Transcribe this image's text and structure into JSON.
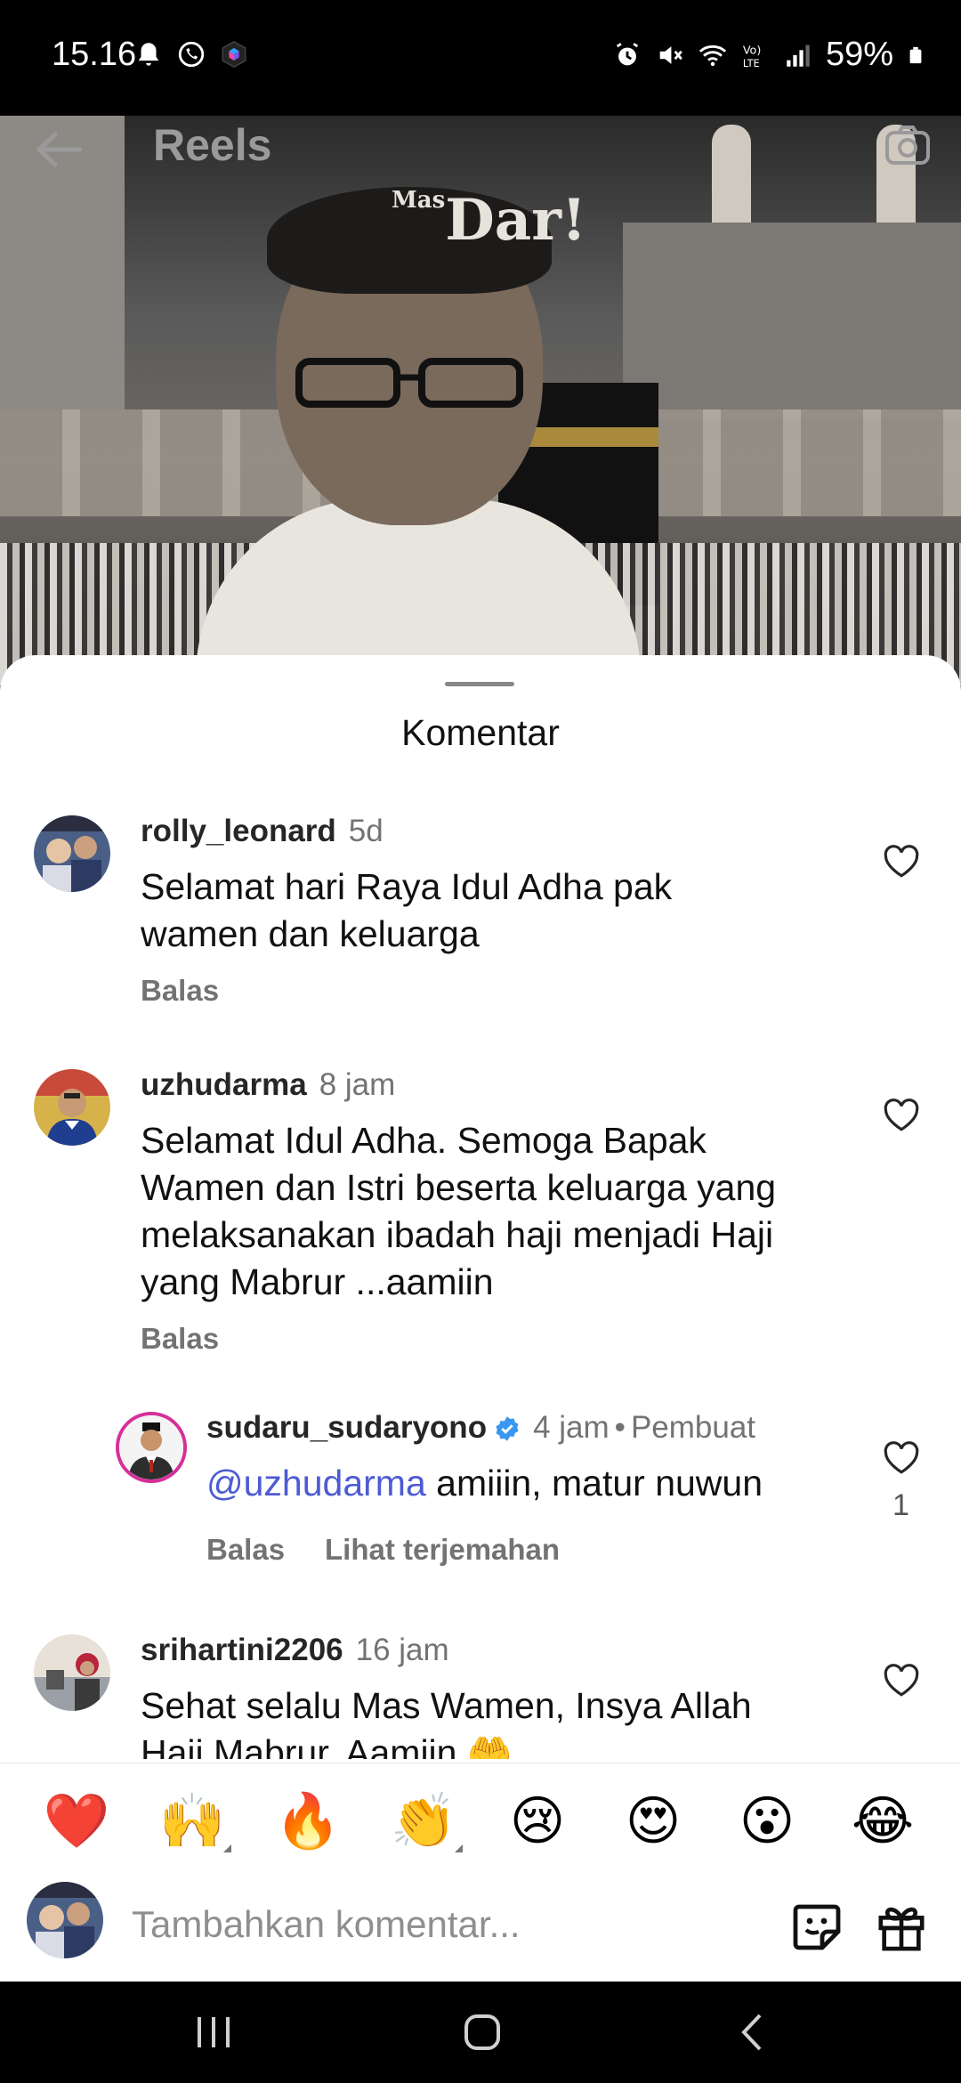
{
  "status_bar": {
    "time": "15.16",
    "battery": "59%",
    "left_icons": [
      "bell-icon",
      "whatsapp-icon",
      "app-icon"
    ],
    "right_icons": [
      "alarm-icon",
      "mute-icon",
      "wifi-icon",
      "volte-icon",
      "signal-icon",
      "battery-icon"
    ]
  },
  "reels": {
    "title": "Reels",
    "watermark_prefix": "Mas",
    "watermark": "Dar!"
  },
  "sheet": {
    "title": "Komentar"
  },
  "comments": [
    {
      "username": "rolly_leonard",
      "time": "5d",
      "text_lines": [
        "Selamat hari Raya Idul Adha pak",
        "wamen dan keluarga"
      ],
      "reply_label": "Balas"
    },
    {
      "username": "uzhudarma",
      "time": "8 jam",
      "text_lines": [
        "Selamat Idul Adha. Semoga Bapak",
        "Wamen dan Istri beserta keluarga yang",
        "melaksanakan ibadah haji menjadi Haji",
        "yang Mabrur ...aamiin"
      ],
      "reply_label": "Balas"
    },
    {
      "username": "sudaru_sudaryono",
      "time": "4 jam",
      "separator": "•",
      "creator_label": "Pembuat",
      "mention": "@uzhudarma",
      "text": " amiiin, matur nuwun",
      "reply_label": "Balas",
      "translate_label": "Lihat terjemahan",
      "likes": "1"
    },
    {
      "username": "srihartini2206",
      "time": "16 jam",
      "text_lines": [
        "Sehat selalu Mas Wamen, Insya Allah",
        "Haji Mabrur, Aamiin 🤲"
      ]
    }
  ],
  "reactions": [
    "❤️",
    "🙌",
    "🔥",
    "👏",
    "😢",
    "😍",
    "😮",
    "😂"
  ],
  "composer": {
    "placeholder": "Tambahkan komentar..."
  },
  "nav": [
    "recent-apps-icon",
    "home-icon",
    "back-icon"
  ]
}
